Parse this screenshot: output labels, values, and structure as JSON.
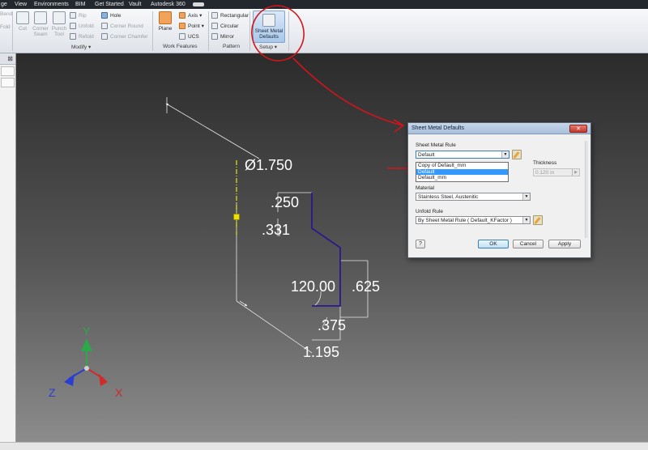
{
  "menu": {
    "items": [
      "ge",
      "View",
      "Environments",
      "BIM",
      "Get Started",
      "Vault",
      "Autodesk 360"
    ]
  },
  "ribbon": {
    "partial_left": {
      "bend": "Bend",
      "fold": "Fold"
    },
    "modify": {
      "cut": "Cut",
      "corner_seam": "Corner\nSeam",
      "punch_tool": "Punch\nTool",
      "rip": "Rip",
      "unfold": "Unfold",
      "refold": "Refold",
      "hole": "Hole",
      "corner_round": "Corner Round",
      "corner_chamfer": "Corner Chamfer",
      "label": "Modify ▾"
    },
    "work_features": {
      "plane": "Plane",
      "axis": "Axis ▾",
      "point": "Point ▾",
      "ucs": "UCS",
      "label": "Work Features"
    },
    "pattern": {
      "rectangular": "Rectangular",
      "circular": "Circular",
      "mirror": "Mirror",
      "label": "Pattern"
    },
    "setup": {
      "sheet_metal_defaults": "Sheet Metal\nDefaults",
      "label": "Setup ▾"
    }
  },
  "viewport": {
    "dimensions": {
      "dia": "Ø1.750",
      "d250": ".250",
      "d331": ".331",
      "d120": "120.00",
      "d625": ".625",
      "d375": ".375",
      "d1195": "1.195"
    },
    "triad": {
      "x": "X",
      "y": "Y",
      "z": "Z"
    }
  },
  "dialog": {
    "title": "Sheet Metal Defaults",
    "close": "✕",
    "sheet_metal_rule_label": "Sheet Metal Rule",
    "sheet_metal_rule_value": "Default",
    "dropdown_options": [
      "Copy of Default_mm",
      "Default",
      "Default_mm"
    ],
    "dropdown_selected": "Default",
    "thickness_label": "Thickness",
    "thickness_value": "0.120 in",
    "material_label": "Material",
    "material_value": "Stainless Steel, Austenitic",
    "unfold_rule_label": "Unfold Rule",
    "unfold_rule_value": "By Sheet Metal Rule ( Default_KFactor )",
    "ok": "OK",
    "cancel": "Cancel",
    "apply": "Apply",
    "help": "?"
  },
  "colors": {
    "annotation_red": "#d4141a",
    "profile_purple": "#2a1a8c",
    "centerline_yellow": "#e5e51a",
    "triad_x": "#d12a2a",
    "triad_y": "#2aa84a",
    "triad_z": "#2a3fd1"
  }
}
